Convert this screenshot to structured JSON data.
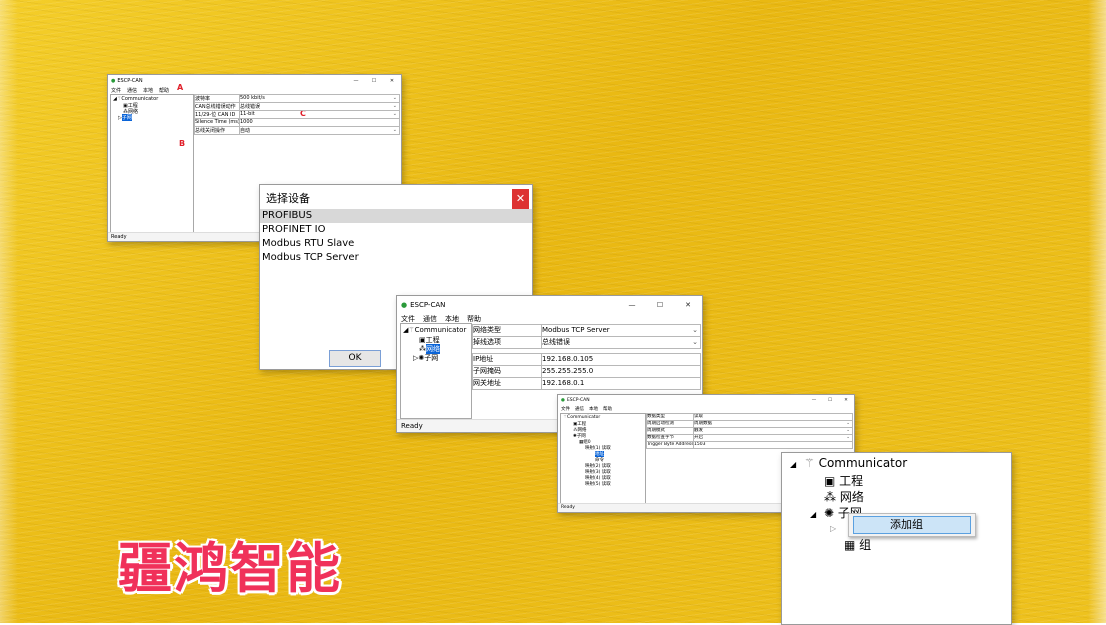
{
  "brand": "疆鸿智能",
  "win1": {
    "title": "ESCP-CAN",
    "controls": {
      "min": "—",
      "max": "☐",
      "close": "✕"
    },
    "menu": [
      "文件",
      "通信",
      "本地",
      "帮助"
    ],
    "tree": {
      "root": "Communicator",
      "items": [
        "工程",
        "网络",
        "子网"
      ]
    },
    "marks": [
      "A",
      "B",
      "C"
    ],
    "rows": [
      {
        "key": "波特率",
        "value": "500 kbit/s"
      },
      {
        "key": "CAN总线错误动作",
        "value": "总线错误"
      },
      {
        "key": "11/29-位 CAN ID",
        "value": "11-bit"
      },
      {
        "key": "Silence Time (ms)",
        "value": "1000"
      },
      {
        "key": "总线关闭操作",
        "value": "自动"
      }
    ],
    "status": "Ready"
  },
  "dialog": {
    "title": "选择设备",
    "close": "✕",
    "options": [
      "PROFIBUS",
      "PROFINET IO",
      "Modbus RTU Slave",
      "Modbus TCP Server"
    ],
    "ok": "OK"
  },
  "win2": {
    "title": "ESCP-CAN",
    "controls": {
      "min": "—",
      "max": "☐",
      "close": "✕"
    },
    "menu": [
      "文件",
      "通信",
      "本地",
      "帮助"
    ],
    "tree": {
      "root": "Communicator",
      "items": [
        "工程",
        "网络",
        "子网"
      ]
    },
    "rows": [
      {
        "key": "网络类型",
        "value": "Modbus TCP Server",
        "dropdown": true
      },
      {
        "key": "掉线选项",
        "value": "总线错误",
        "dropdown": true
      },
      {
        "key": "IP地址",
        "value": "192.168.0.105"
      },
      {
        "key": "子网掩码",
        "value": "255.255.255.0"
      },
      {
        "key": "网关地址",
        "value": "192.168.0.1"
      }
    ],
    "status": "Ready"
  },
  "win3": {
    "title": "ESCP-CAN",
    "controls": {
      "min": "—",
      "max": "☐",
      "close": "✕"
    },
    "menu": [
      "文件",
      "通信",
      "本地",
      "帮助"
    ],
    "tree": {
      "root": "Communicator",
      "items": [
        "工程",
        "网络",
        "子网",
        "组0",
        "映射(1) 读取",
        "地址",
        "命令",
        "映射(2) 读取",
        "映射(3) 读取",
        "映射(4) 读取",
        "映射(5) 读取"
      ]
    },
    "rows": [
      {
        "key": "数据类型",
        "value": "读取"
      },
      {
        "key": "周期启动检测",
        "value": "周期数据"
      },
      {
        "key": "周期模式",
        "value": "触发"
      },
      {
        "key": "数据检查字节",
        "value": "开启"
      },
      {
        "key": "Trigger Byte Address",
        "value": "1503"
      }
    ],
    "status": "Ready"
  },
  "zoom": {
    "root": "Communicator",
    "items": [
      "工程",
      "网络",
      "子网"
    ],
    "group": "组",
    "context_item": "添加组"
  }
}
